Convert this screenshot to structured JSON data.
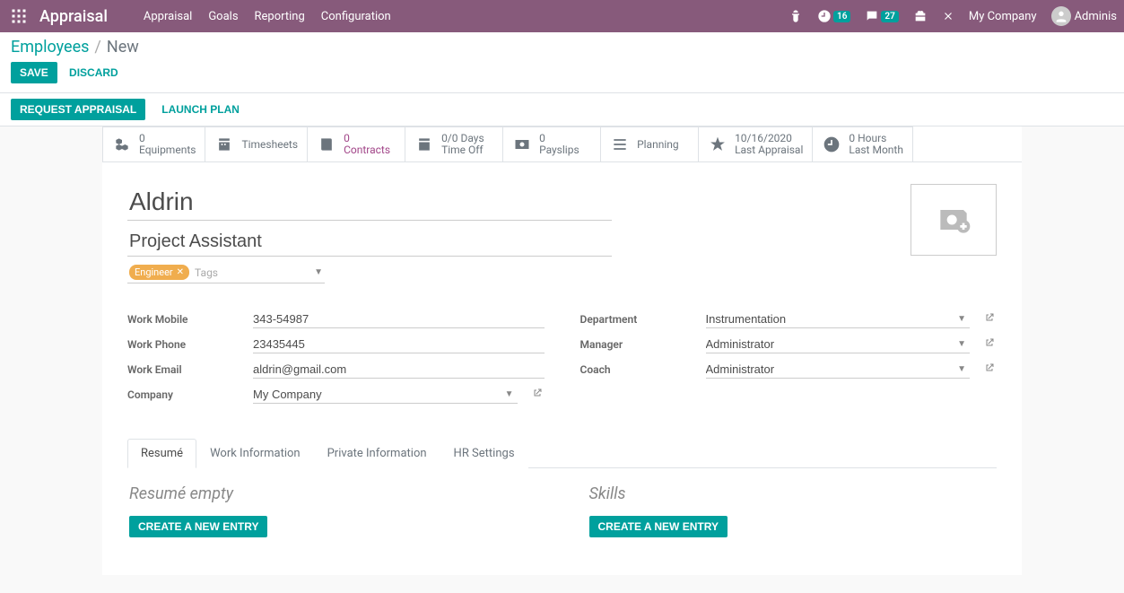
{
  "topbar": {
    "brand": "Appraisal",
    "menu": [
      "Appraisal",
      "Goals",
      "Reporting",
      "Configuration"
    ],
    "activity_badge": "16",
    "discuss_badge": "27",
    "company": "My Company",
    "user": "Adminis"
  },
  "breadcrumb": {
    "root": "Employees",
    "current": "New"
  },
  "actions": {
    "save": "Save",
    "discard": "Discard"
  },
  "status_buttons": {
    "request_appraisal": "Request Appraisal",
    "launch_plan": "Launch Plan"
  },
  "stat": {
    "equipments": {
      "val": "0",
      "label": "Equipments"
    },
    "timesheets": {
      "label": "Timesheets"
    },
    "contracts": {
      "val": "0",
      "label": "Contracts"
    },
    "timeoff": {
      "val": "0/0 Days",
      "label": "Time Off"
    },
    "payslips": {
      "val": "0",
      "label": "Payslips"
    },
    "planning": {
      "label": "Planning"
    },
    "last_appraisal": {
      "val": "10/16/2020",
      "label": "Last Appraisal"
    },
    "last_month": {
      "val": "0 Hours",
      "label": "Last Month"
    }
  },
  "employee": {
    "name": "Aldrin",
    "job_title": "Project Assistant",
    "tag": "Engineer",
    "tags_placeholder": "Tags"
  },
  "fields": {
    "left": {
      "work_mobile": {
        "label": "Work Mobile",
        "value": "343-54987"
      },
      "work_phone": {
        "label": "Work Phone",
        "value": "23435445"
      },
      "work_email": {
        "label": "Work Email",
        "value": "aldrin@gmail.com"
      },
      "company": {
        "label": "Company",
        "value": "My Company"
      }
    },
    "right": {
      "department": {
        "label": "Department",
        "value": "Instrumentation"
      },
      "manager": {
        "label": "Manager",
        "value": "Administrator"
      },
      "coach": {
        "label": "Coach",
        "value": "Administrator"
      }
    }
  },
  "tabs": [
    "Resumé",
    "Work Information",
    "Private Information",
    "HR Settings"
  ],
  "tab_content": {
    "resume_title": "Resumé empty",
    "resume_btn": "Create a new entry",
    "skills_title": "Skills",
    "skills_btn": "Create a new entry"
  }
}
